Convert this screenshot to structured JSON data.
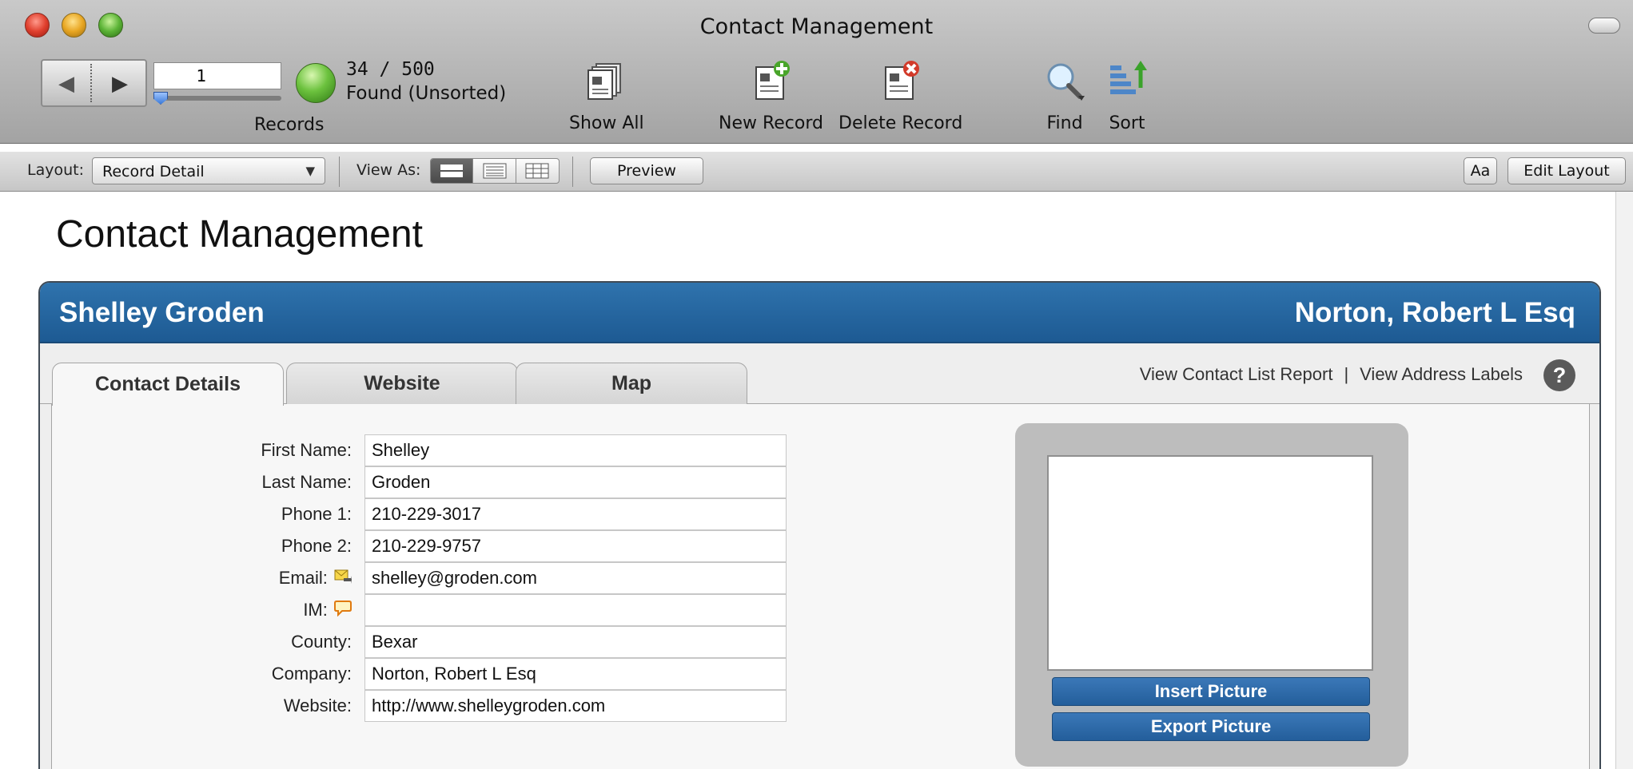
{
  "window": {
    "title": "Contact Management"
  },
  "toolbar": {
    "record_number": "1",
    "found_count": "34 / 500",
    "found_status": "Found (Unsorted)",
    "records_label": "Records",
    "show_all_label": "Show All",
    "new_record_label": "New Record",
    "delete_record_label": "Delete Record",
    "find_label": "Find",
    "sort_label": "Sort"
  },
  "statusbar": {
    "layout_label": "Layout:",
    "layout_value": "Record Detail",
    "view_as_label": "View As:",
    "view_modes": [
      "form-view-icon",
      "list-view-icon",
      "table-view-icon"
    ],
    "active_view": "form",
    "preview_label": "Preview",
    "text_format_label": "Aa",
    "edit_layout_label": "Edit Layout"
  },
  "content": {
    "title": "Contact Management",
    "header_name": "Shelley Groden",
    "header_company": "Norton, Robert L Esq",
    "tabs": [
      {
        "label": "Contact Details",
        "active": true
      },
      {
        "label": "Website",
        "active": false
      },
      {
        "label": "Map",
        "active": false
      }
    ],
    "links": {
      "contact_list": "View Contact List Report",
      "separator": "|",
      "address_labels": "View Address Labels"
    },
    "help_label": "?",
    "fields": [
      {
        "label": "First Name:",
        "value": "Shelley"
      },
      {
        "label": "Last Name:",
        "value": "Groden"
      },
      {
        "label": "Phone 1:",
        "value": "210-229-3017"
      },
      {
        "label": "Phone 2:",
        "value": "210-229-9757"
      },
      {
        "label": "Email:",
        "value": "shelley@groden.com",
        "icon": "send-email-icon"
      },
      {
        "label": "IM:",
        "value": "",
        "icon": "chat-bubble-icon"
      },
      {
        "label": "County:",
        "value": "Bexar"
      },
      {
        "label": "Company:",
        "value": "Norton, Robert L Esq"
      },
      {
        "label": "Website:",
        "value": "http://www.shelleygroden.com"
      }
    ],
    "picture": {
      "insert_label": "Insert Picture",
      "export_label": "Export Picture"
    }
  },
  "colors": {
    "header_blue": "#1d5a93",
    "button_blue": "#2a67a6",
    "status_green": "#6cc23e",
    "toolbar_gray": "#a3a3a3"
  }
}
